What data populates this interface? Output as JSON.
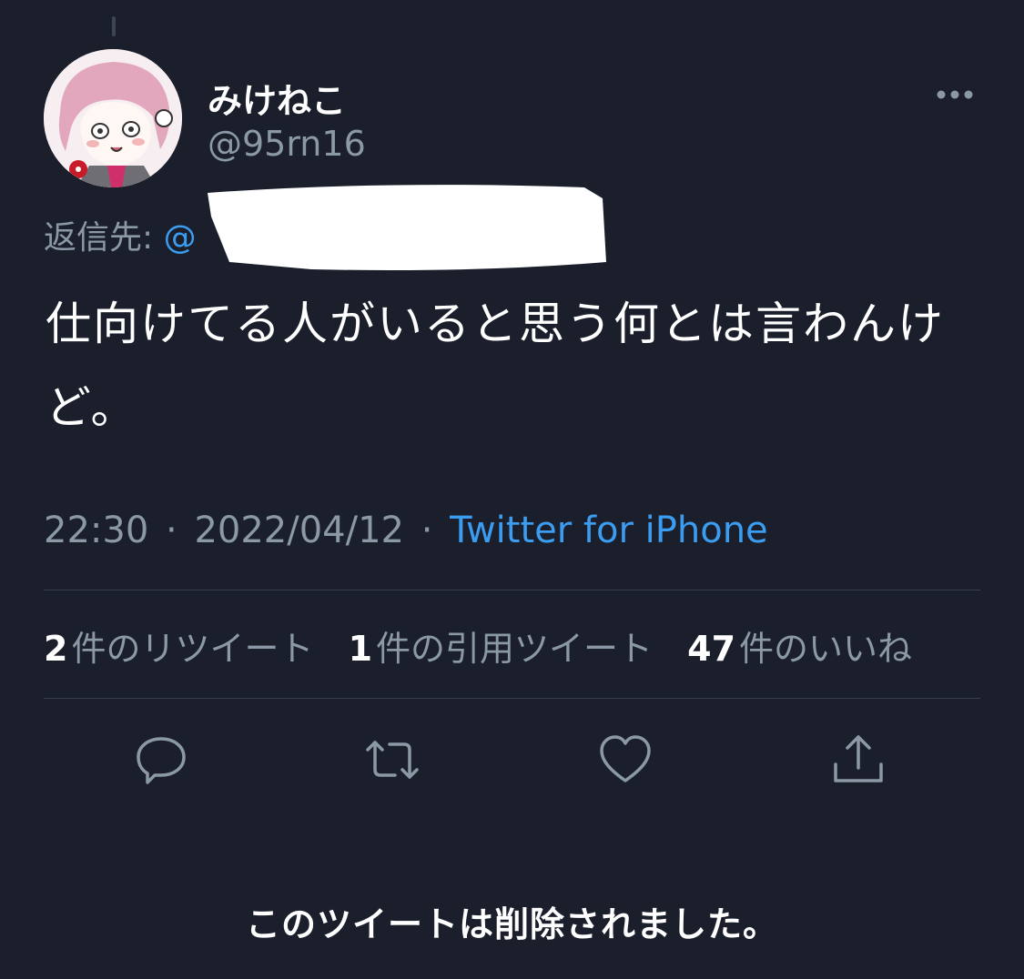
{
  "colors": {
    "background": "#1a1f2b",
    "text_primary": "#ffffff",
    "text_secondary": "#8b98a5",
    "accent": "#3b9cf0",
    "divider": "#38404c"
  },
  "author": {
    "display_name": "みけねこ",
    "handle": "@95rn16",
    "avatar": "anime-girl-avatar"
  },
  "reply": {
    "prefix": "返信先:",
    "mention": "@"
  },
  "tweet": {
    "text": "仕向けてる人がいると思う何とは言わんけど。",
    "time": "22:30",
    "date": "2022/04/12",
    "separator": "·",
    "source": "Twitter for iPhone"
  },
  "stats": {
    "retweets_count": "2",
    "retweets_label": "件のリツイート",
    "quotes_count": "1",
    "quotes_label": "件の引用ツイート",
    "likes_count": "47",
    "likes_label": "件のいいね"
  },
  "actions": [
    "reply-icon",
    "retweet-icon",
    "like-icon",
    "share-icon"
  ],
  "notice": "このツイートは削除されました。"
}
